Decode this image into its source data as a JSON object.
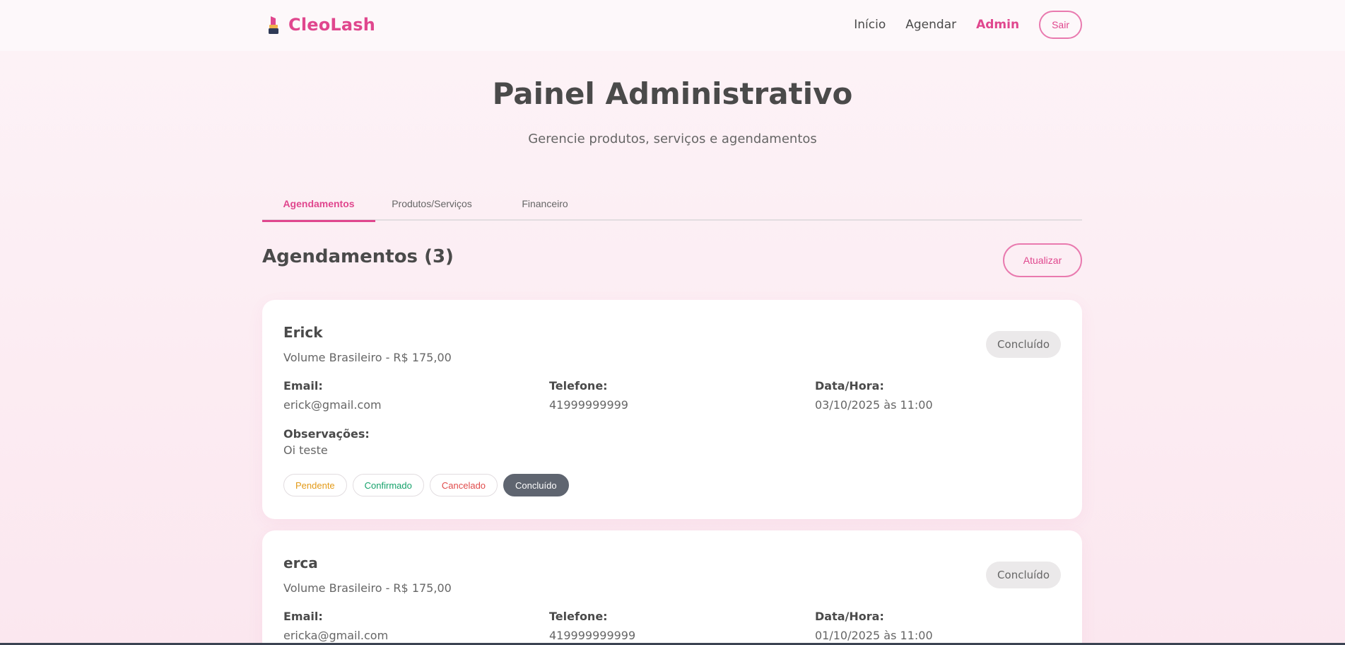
{
  "header": {
    "brand": "CleoLash",
    "brand_icon": "lipstick-icon",
    "nav": [
      "Início",
      "Agendar",
      "Admin"
    ],
    "active_nav": "Admin",
    "logout_label": "Sair"
  },
  "page": {
    "title": "Painel Administrativo",
    "subtitle": "Gerencie produtos, serviços e agendamentos"
  },
  "tabs": [
    "Agendamentos",
    "Produtos/Serviços",
    "Financeiro"
  ],
  "active_tab": "Agendamentos",
  "section": {
    "title": "Agendamentos (3)",
    "refresh_label": "Atualizar"
  },
  "labels": {
    "email": "Email:",
    "phone": "Telefone:",
    "datetime": "Data/Hora:",
    "notes": "Observações:"
  },
  "status_actions": [
    "Pendente",
    "Confirmado",
    "Cancelado",
    "Concluído"
  ],
  "appointments": [
    {
      "name": "Erick",
      "service": "Volume Brasileiro - R$ 175,00",
      "status": "Concluído",
      "email": "erick@gmail.com",
      "phone": "41999999999",
      "datetime": "03/10/2025 às 11:00",
      "notes": "Oi teste"
    },
    {
      "name": "erca",
      "service": "Volume Brasileiro - R$ 175,00",
      "status": "Concluído",
      "email": "ericka@gmail.com",
      "phone": "419999999999",
      "datetime": "01/10/2025 às 11:00"
    }
  ],
  "colors": {
    "accent": "#e0478e",
    "pending": "#e39a17",
    "confirmed": "#15a26b",
    "cancelled": "#e04a4a",
    "done": "#5f6570"
  }
}
